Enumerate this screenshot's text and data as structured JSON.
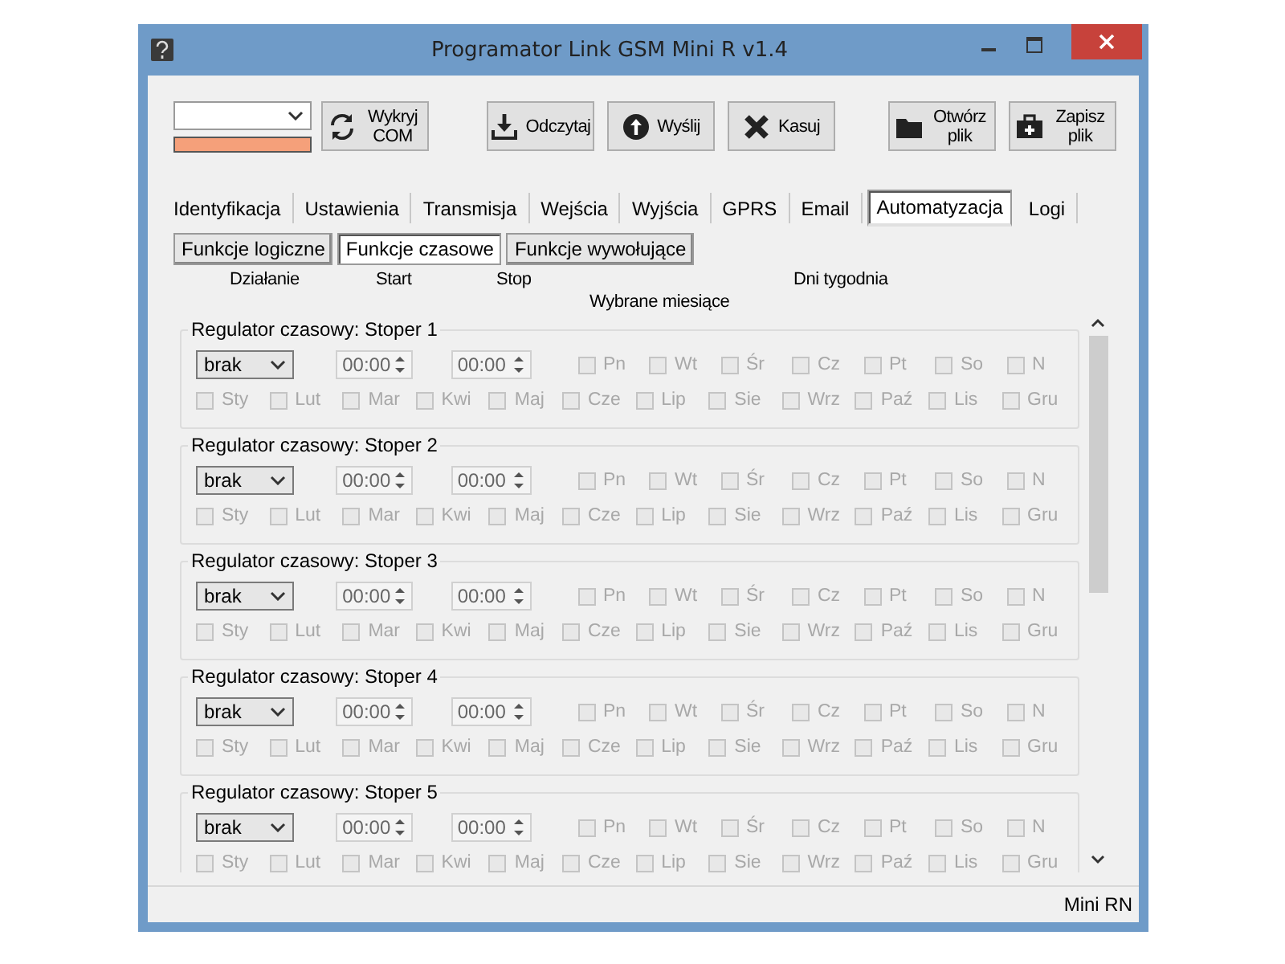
{
  "window": {
    "title": "Programator Link GSM Mini R v1.4"
  },
  "toolbar": {
    "connection_bar": {
      "level": 1,
      "color": "#f5a07a"
    },
    "buttons": [
      {
        "label": "Wykryj COM"
      },
      {
        "label": "Odczytaj"
      },
      {
        "label": "Wyślij"
      },
      {
        "label": "Kasuj"
      },
      {
        "label": "Otwórz plik"
      },
      {
        "label": "Zapisz plik"
      }
    ]
  },
  "tabs": [
    {
      "label": "Identyfikacja",
      "selected": false
    },
    {
      "label": "Ustawienia",
      "selected": false
    },
    {
      "label": "Transmisja",
      "selected": false
    },
    {
      "label": "Wejścia",
      "selected": false
    },
    {
      "label": "Wyjścia",
      "selected": false
    },
    {
      "label": "GPRS",
      "selected": false
    },
    {
      "label": "Email",
      "selected": false
    },
    {
      "label": "Automatyzacja",
      "selected": true
    },
    {
      "label": "Logi",
      "selected": false
    }
  ],
  "subtabs": [
    {
      "label": "Funkcje logiczne",
      "selected": false
    },
    {
      "label": "Funkcje czasowe",
      "selected": true
    },
    {
      "label": "Funkcje wywołujące",
      "selected": false
    }
  ],
  "column_headers": {
    "action": "Działanie",
    "start": "Start",
    "stop": "Stop",
    "months": "Wybrane miesiące",
    "days": "Dni tygodnia"
  },
  "timers": [
    {
      "title": "Regulator czasowy: Stoper 1",
      "action": "brak",
      "start": "00:00",
      "stop": "00:00",
      "days": [
        {
          "label": "Pn",
          "checked": false,
          "disabled": true
        },
        {
          "label": "Wt",
          "checked": false,
          "disabled": true
        },
        {
          "label": "Śr",
          "checked": false,
          "disabled": true
        },
        {
          "label": "Cz",
          "checked": false,
          "disabled": true
        },
        {
          "label": "Pt",
          "checked": false,
          "disabled": true
        },
        {
          "label": "So",
          "checked": false,
          "disabled": true
        },
        {
          "label": "N",
          "checked": false,
          "disabled": true
        }
      ],
      "months": [
        {
          "label": "Sty",
          "checked": false,
          "disabled": true
        },
        {
          "label": "Lut",
          "checked": false,
          "disabled": true
        },
        {
          "label": "Mar",
          "checked": false,
          "disabled": true
        },
        {
          "label": "Kwi",
          "checked": false,
          "disabled": true
        },
        {
          "label": "Maj",
          "checked": false,
          "disabled": true
        },
        {
          "label": "Cze",
          "checked": false,
          "disabled": true
        },
        {
          "label": "Lip",
          "checked": false,
          "disabled": true
        },
        {
          "label": "Sie",
          "checked": false,
          "disabled": true
        },
        {
          "label": "Wrz",
          "checked": false,
          "disabled": true
        },
        {
          "label": "Paź",
          "checked": false,
          "disabled": true
        },
        {
          "label": "Lis",
          "checked": false,
          "disabled": true
        },
        {
          "label": "Gru",
          "checked": false,
          "disabled": true
        }
      ]
    },
    {
      "title": "Regulator czasowy: Stoper 2",
      "action": "brak",
      "start": "00:00",
      "stop": "00:00",
      "days": [
        {
          "label": "Pn",
          "checked": false,
          "disabled": true
        },
        {
          "label": "Wt",
          "checked": false,
          "disabled": true
        },
        {
          "label": "Śr",
          "checked": false,
          "disabled": true
        },
        {
          "label": "Cz",
          "checked": false,
          "disabled": true
        },
        {
          "label": "Pt",
          "checked": false,
          "disabled": true
        },
        {
          "label": "So",
          "checked": false,
          "disabled": true
        },
        {
          "label": "N",
          "checked": false,
          "disabled": true
        }
      ],
      "months": [
        {
          "label": "Sty",
          "checked": false,
          "disabled": true
        },
        {
          "label": "Lut",
          "checked": false,
          "disabled": true
        },
        {
          "label": "Mar",
          "checked": false,
          "disabled": true
        },
        {
          "label": "Kwi",
          "checked": false,
          "disabled": true
        },
        {
          "label": "Maj",
          "checked": false,
          "disabled": true
        },
        {
          "label": "Cze",
          "checked": false,
          "disabled": true
        },
        {
          "label": "Lip",
          "checked": false,
          "disabled": true
        },
        {
          "label": "Sie",
          "checked": false,
          "disabled": true
        },
        {
          "label": "Wrz",
          "checked": false,
          "disabled": true
        },
        {
          "label": "Paź",
          "checked": false,
          "disabled": true
        },
        {
          "label": "Lis",
          "checked": false,
          "disabled": true
        },
        {
          "label": "Gru",
          "checked": false,
          "disabled": true
        }
      ]
    },
    {
      "title": "Regulator czasowy: Stoper 3",
      "action": "brak",
      "start": "00:00",
      "stop": "00:00",
      "days": [
        {
          "label": "Pn",
          "checked": false,
          "disabled": true
        },
        {
          "label": "Wt",
          "checked": false,
          "disabled": true
        },
        {
          "label": "Śr",
          "checked": false,
          "disabled": true
        },
        {
          "label": "Cz",
          "checked": false,
          "disabled": true
        },
        {
          "label": "Pt",
          "checked": false,
          "disabled": true
        },
        {
          "label": "So",
          "checked": false,
          "disabled": true
        },
        {
          "label": "N",
          "checked": false,
          "disabled": true
        }
      ],
      "months": [
        {
          "label": "Sty",
          "checked": false,
          "disabled": true
        },
        {
          "label": "Lut",
          "checked": false,
          "disabled": true
        },
        {
          "label": "Mar",
          "checked": false,
          "disabled": true
        },
        {
          "label": "Kwi",
          "checked": false,
          "disabled": true
        },
        {
          "label": "Maj",
          "checked": false,
          "disabled": true
        },
        {
          "label": "Cze",
          "checked": false,
          "disabled": true
        },
        {
          "label": "Lip",
          "checked": false,
          "disabled": true
        },
        {
          "label": "Sie",
          "checked": false,
          "disabled": true
        },
        {
          "label": "Wrz",
          "checked": false,
          "disabled": true
        },
        {
          "label": "Paź",
          "checked": false,
          "disabled": true
        },
        {
          "label": "Lis",
          "checked": false,
          "disabled": true
        },
        {
          "label": "Gru",
          "checked": false,
          "disabled": true
        }
      ]
    },
    {
      "title": "Regulator czasowy: Stoper 4",
      "action": "brak",
      "start": "00:00",
      "stop": "00:00",
      "days": [
        {
          "label": "Pn",
          "checked": false,
          "disabled": true
        },
        {
          "label": "Wt",
          "checked": false,
          "disabled": true
        },
        {
          "label": "Śr",
          "checked": false,
          "disabled": true
        },
        {
          "label": "Cz",
          "checked": false,
          "disabled": true
        },
        {
          "label": "Pt",
          "checked": false,
          "disabled": true
        },
        {
          "label": "So",
          "checked": false,
          "disabled": true
        },
        {
          "label": "N",
          "checked": false,
          "disabled": true
        }
      ],
      "months": [
        {
          "label": "Sty",
          "checked": false,
          "disabled": true
        },
        {
          "label": "Lut",
          "checked": false,
          "disabled": true
        },
        {
          "label": "Mar",
          "checked": false,
          "disabled": true
        },
        {
          "label": "Kwi",
          "checked": false,
          "disabled": true
        },
        {
          "label": "Maj",
          "checked": false,
          "disabled": true
        },
        {
          "label": "Cze",
          "checked": false,
          "disabled": true
        },
        {
          "label": "Lip",
          "checked": false,
          "disabled": true
        },
        {
          "label": "Sie",
          "checked": false,
          "disabled": true
        },
        {
          "label": "Wrz",
          "checked": false,
          "disabled": true
        },
        {
          "label": "Paź",
          "checked": false,
          "disabled": true
        },
        {
          "label": "Lis",
          "checked": false,
          "disabled": true
        },
        {
          "label": "Gru",
          "checked": false,
          "disabled": true
        }
      ]
    },
    {
      "title": "Regulator czasowy: Stoper 5",
      "action": "brak",
      "start": "00:00",
      "stop": "00:00",
      "days": [
        {
          "label": "Pn",
          "checked": false,
          "disabled": true
        },
        {
          "label": "Wt",
          "checked": false,
          "disabled": true
        },
        {
          "label": "Śr",
          "checked": false,
          "disabled": true
        },
        {
          "label": "Cz",
          "checked": false,
          "disabled": true
        },
        {
          "label": "Pt",
          "checked": false,
          "disabled": true
        },
        {
          "label": "So",
          "checked": false,
          "disabled": true
        },
        {
          "label": "N",
          "checked": false,
          "disabled": true
        }
      ],
      "months": [
        {
          "label": "Sty",
          "checked": false,
          "disabled": true
        },
        {
          "label": "Lut",
          "checked": false,
          "disabled": true
        },
        {
          "label": "Mar",
          "checked": false,
          "disabled": true
        },
        {
          "label": "Kwi",
          "checked": false,
          "disabled": true
        },
        {
          "label": "Maj",
          "checked": false,
          "disabled": true
        },
        {
          "label": "Cze",
          "checked": false,
          "disabled": true
        },
        {
          "label": "Lip",
          "checked": false,
          "disabled": true
        },
        {
          "label": "Sie",
          "checked": false,
          "disabled": true
        },
        {
          "label": "Wrz",
          "checked": false,
          "disabled": true
        },
        {
          "label": "Paź",
          "checked": false,
          "disabled": true
        },
        {
          "label": "Lis",
          "checked": false,
          "disabled": true
        },
        {
          "label": "Gru",
          "checked": false,
          "disabled": true
        }
      ]
    }
  ],
  "status_bar": {
    "text": "Mini RN"
  }
}
